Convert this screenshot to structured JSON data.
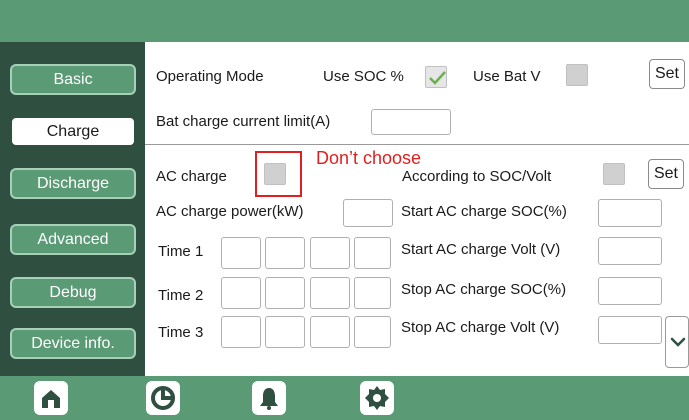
{
  "colors": {
    "brand": "#5a9a74",
    "sidebar": "#2f4f40",
    "annotation": "#e02020"
  },
  "sidebar": {
    "items": [
      {
        "label": "Basic"
      },
      {
        "label": "Charge"
      },
      {
        "label": "Discharge"
      },
      {
        "label": "Advanced"
      },
      {
        "label": "Debug"
      },
      {
        "label": "Device info."
      }
    ],
    "active": "Charge"
  },
  "mode": {
    "label": "Operating Mode",
    "use_soc_label": "Use SOC %",
    "use_soc_checked": true,
    "use_batv_label": "Use Bat V",
    "use_batv_checked": false,
    "set_label": "Set"
  },
  "bat_charge_limit": {
    "label": "Bat charge current limit(A)",
    "value": ""
  },
  "ac": {
    "charge_label": "AC charge",
    "charge_checked": false,
    "annotation": "Don’t choose",
    "according_label": "According to SOC/Volt",
    "according_checked": false,
    "set_label": "Set",
    "power_label": "AC charge power(kW)",
    "power_value": "",
    "times": [
      {
        "label": "Time  1"
      },
      {
        "label": "Time  2"
      },
      {
        "label": "Time  3"
      }
    ],
    "start_soc_label": "Start AC charge SOC(%)",
    "start_volt_label": "Start AC charge Volt (V)",
    "stop_soc_label": "Stop AC charge SOC(%)",
    "stop_volt_label": "Stop AC charge Volt (V)"
  },
  "nav": {
    "icons": [
      "home-icon",
      "chart-icon",
      "bell-icon",
      "gear-icon"
    ]
  }
}
